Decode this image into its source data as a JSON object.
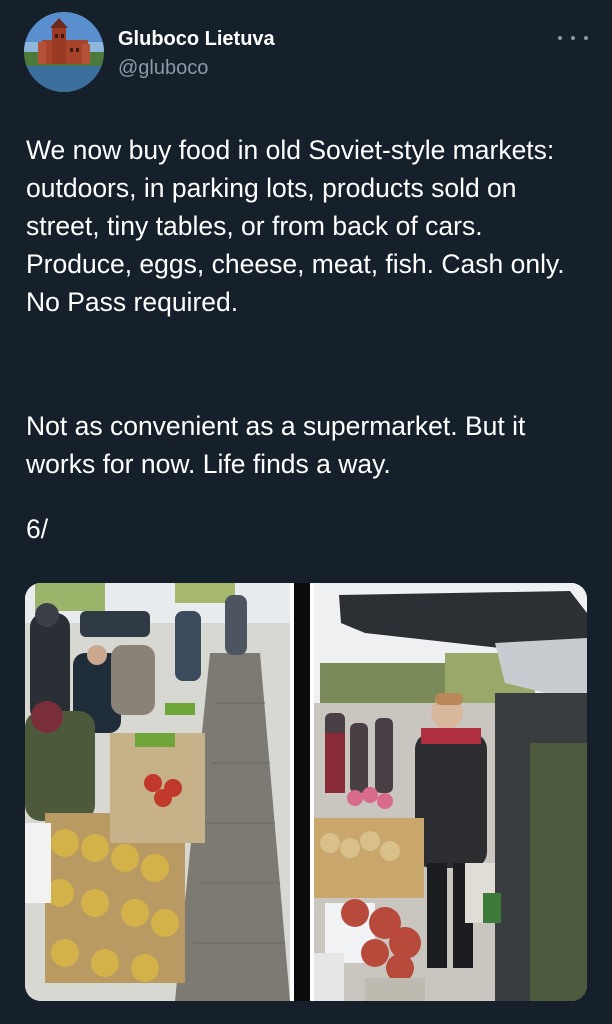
{
  "author": {
    "display_name": "Gluboco Lietuva",
    "handle": "@gluboco",
    "avatar_icon": "castle-avatar-icon"
  },
  "menu": {
    "icon": "more-options-icon"
  },
  "tweet": {
    "paragraph_1": "We now buy food in old Soviet-style markets: outdoors, in parking lots, products sold on street, tiny tables, or from back of cars. Produce, eggs, cheese, meat, fish. Cash only. No Pass required.",
    "paragraph_2": "Not as convenient as a supermarket. But it works for now. Life finds a way.",
    "paragraph_3": "6/"
  },
  "media": {
    "photo_left": "outdoor-market-street-photo",
    "photo_right": "car-trunk-market-photo"
  },
  "colors": {
    "background": "#15202b",
    "text": "#ffffff",
    "secondary_text": "#8b98a5"
  }
}
